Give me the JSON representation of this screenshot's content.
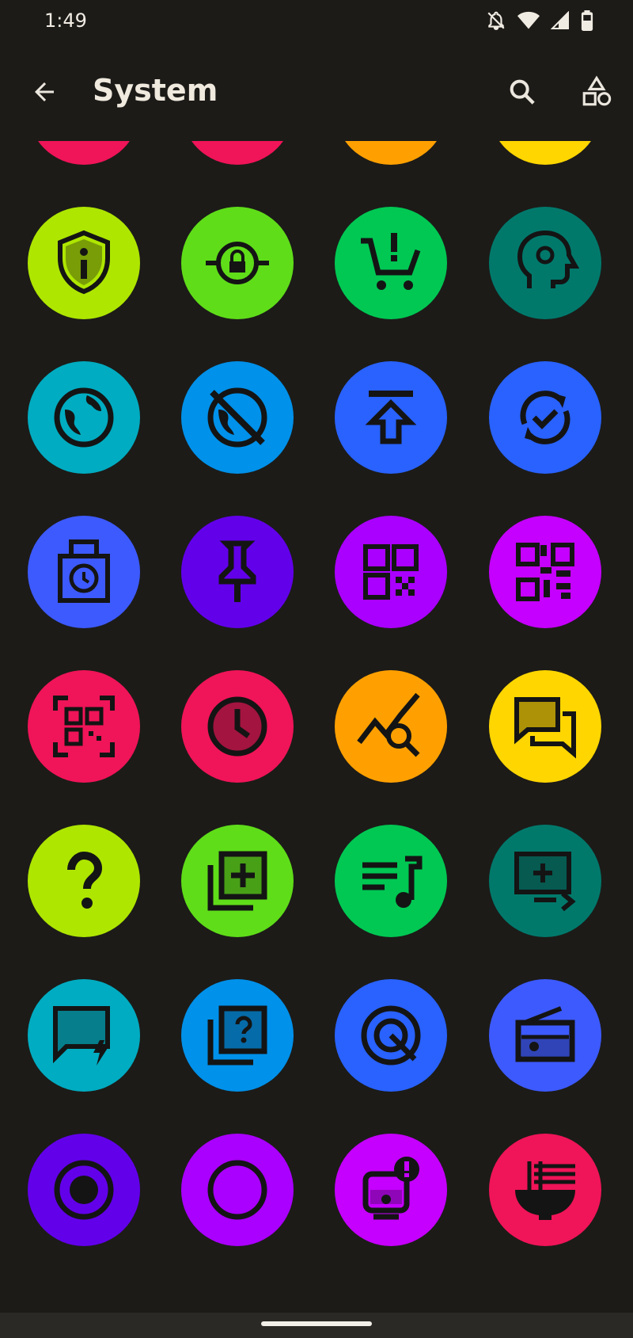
{
  "status": {
    "time": "1:49"
  },
  "app_bar": {
    "title": "System",
    "back_icon": "arrow-left-icon",
    "search_icon": "search-icon",
    "shapes_icon": "shapes-icon"
  },
  "icons": [
    {
      "name": "verified-user-icon",
      "color": "#f01458"
    },
    {
      "name": "print-icon",
      "color": "#f01458"
    },
    {
      "name": "image-not-supported-icon",
      "color": "#ffa000"
    },
    {
      "name": "priority-icon",
      "color": "#ffd600"
    },
    {
      "name": "security-info-icon",
      "color": "#aee600"
    },
    {
      "name": "vpn-lock-icon",
      "color": "#5fdd19"
    },
    {
      "name": "cart-alert-icon",
      "color": "#00c853"
    },
    {
      "name": "psychology-icon",
      "color": "#00796b"
    },
    {
      "name": "globe-icon",
      "color": "#00acc1"
    },
    {
      "name": "globe-off-icon",
      "color": "#0091ea"
    },
    {
      "name": "publish-icon",
      "color": "#2962ff"
    },
    {
      "name": "sync-check-icon",
      "color": "#2962ff"
    },
    {
      "name": "pending-clock-box-icon",
      "color": "#3d5afe"
    },
    {
      "name": "push-pin-icon",
      "color": "#6200ea"
    },
    {
      "name": "qr-code-icon",
      "color": "#aa00ff"
    },
    {
      "name": "qr-code-2-icon",
      "color": "#c500ff"
    },
    {
      "name": "qr-scanner-icon",
      "color": "#f01458"
    },
    {
      "name": "clock-icon",
      "color": "#f01458"
    },
    {
      "name": "query-stats-icon",
      "color": "#ffa000"
    },
    {
      "name": "chat-forum-icon",
      "color": "#ffd600"
    },
    {
      "name": "help-icon",
      "color": "#aee600"
    },
    {
      "name": "library-add-icon",
      "color": "#5fdd19"
    },
    {
      "name": "queue-music-icon",
      "color": "#00c853"
    },
    {
      "name": "screen-share-add-icon",
      "color": "#00796b"
    },
    {
      "name": "quick-reply-icon",
      "color": "#00acc1"
    },
    {
      "name": "quiz-icon",
      "color": "#0091ea"
    },
    {
      "name": "radar-icon",
      "color": "#2962ff"
    },
    {
      "name": "radio-icon",
      "color": "#3d5afe"
    },
    {
      "name": "radio-checked-icon",
      "color": "#6200ea"
    },
    {
      "name": "radio-unchecked-icon",
      "color": "#aa00ff"
    },
    {
      "name": "device-alert-icon",
      "color": "#c500ff"
    },
    {
      "name": "ramen-dining-icon",
      "color": "#f01458"
    }
  ]
}
